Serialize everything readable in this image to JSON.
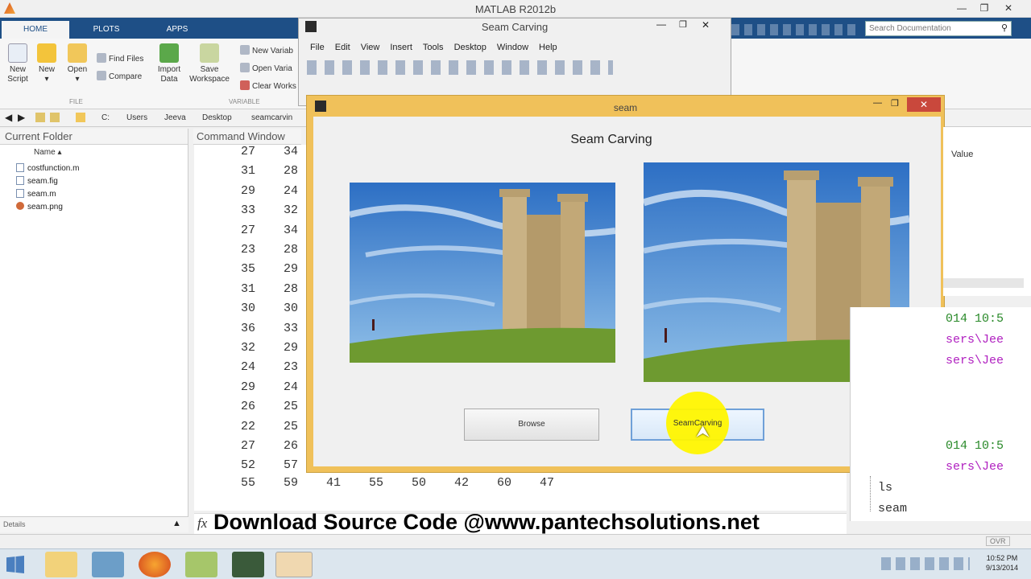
{
  "app": {
    "title": "MATLAB R2012b"
  },
  "ribbon": {
    "tabs": [
      "HOME",
      "PLOTS",
      "APPS"
    ],
    "buttons": {
      "new_script": "New Script",
      "new": "New",
      "open": "Open",
      "find_files": "Find Files",
      "compare": "Compare",
      "import": "Import Data",
      "save_ws": "Save Workspace",
      "new_var": "New Variab",
      "open_var": "Open Varia",
      "clear_ws": "Clear Works"
    },
    "groups": {
      "file": "FILE",
      "variable": "VARIABLE"
    }
  },
  "search": {
    "placeholder": "Search Documentation"
  },
  "address": {
    "crumbs": [
      "C:",
      "Users",
      "Jeeva",
      "Desktop",
      "seamcarvin"
    ]
  },
  "current_folder": {
    "title": "Current Folder",
    "col": "Name ▴",
    "files": [
      "costfunction.m",
      "seam.fig",
      "seam.m",
      "seam.png"
    ],
    "details": "Details"
  },
  "command_window": {
    "title": "Command Window",
    "rows": [
      [
        "27",
        "34"
      ],
      [
        "31",
        "28"
      ],
      [
        "29",
        "24"
      ],
      [
        "33",
        "32"
      ],
      [
        "27",
        "34"
      ],
      [
        "23",
        "28"
      ],
      [
        "35",
        "29"
      ],
      [
        "31",
        "28"
      ],
      [
        "30",
        "30"
      ],
      [
        "36",
        "33"
      ],
      [
        "32",
        "29"
      ],
      [
        "24",
        "23"
      ],
      [
        "29",
        "24"
      ],
      [
        "26",
        "25"
      ],
      [
        "22",
        "25"
      ],
      [
        "27",
        "26"
      ],
      [
        "52",
        "57"
      ]
    ],
    "last_row": [
      "55",
      "59",
      "41",
      "55",
      "50",
      "42",
      "60",
      "47"
    ],
    "fx": "fx"
  },
  "figure": {
    "title": "Seam Carving",
    "menu": [
      "File",
      "Edit",
      "View",
      "Insert",
      "Tools",
      "Desktop",
      "Window",
      "Help"
    ]
  },
  "seam": {
    "title": "seam",
    "heading": "Seam Carving",
    "browse": "Browse",
    "carve": "SeamCarving"
  },
  "workspace": {
    "value_col": "Value"
  },
  "history": {
    "stamp1": "014 10:5",
    "path1": "sers\\Jee",
    "path2": "sers\\Jee",
    "stamp2": "014 10:5",
    "path3": "sers\\Jee",
    "cmd_ls": "ls",
    "cmd_seam": "seam"
  },
  "overlay": {
    "text": "Download Source Code @www.pantechsolutions.net"
  },
  "status": {
    "ovr": "OVR"
  },
  "clock": {
    "time": "10:52 PM",
    "date": "9/13/2014"
  },
  "colors": {
    "ribbon_blue": "#1e4f86",
    "seam_frame": "#f0c15a",
    "highlight": "#fff600",
    "history_purple": "#b020c0"
  }
}
